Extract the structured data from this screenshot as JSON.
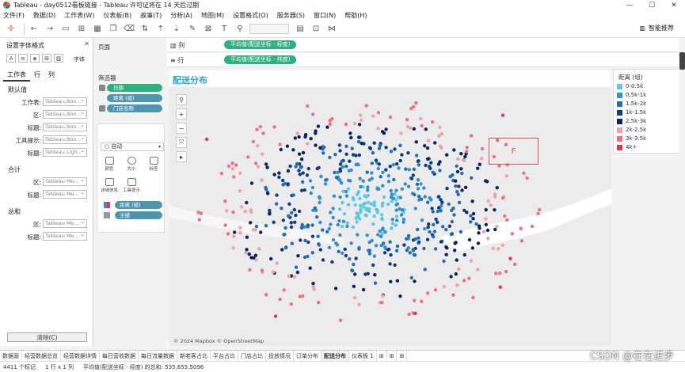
{
  "window": {
    "title": "Tableau - day0512看板链接 - Tableau 许可证将在 14 天后过期"
  },
  "menu": [
    "文件(F)",
    "数据(D)",
    "工作表(W)",
    "仪表板(B)",
    "故事(T)",
    "分析(A)",
    "地图(M)",
    "设置格式(O)",
    "服务器(S)",
    "窗口(N)",
    "帮助(H)"
  ],
  "toolbar": {
    "ai_label": "智能推荐"
  },
  "format_panel": {
    "title": "设置字体格式",
    "font_label": "字体",
    "tabs": [
      "工作表",
      "行",
      "列"
    ],
    "default_section": "默认值",
    "default_rows": [
      {
        "label": "工作表:",
        "value": "Tableau Boo..."
      },
      {
        "label": "区:",
        "value": "Tableau Boo..."
      },
      {
        "label": "标题:",
        "value": "Tableau Boo..."
      },
      {
        "label": "工具提示:",
        "value": "Tableau Boo..."
      },
      {
        "label": "标题:",
        "value": "Tableau Ligh..."
      }
    ],
    "total_section": "合计",
    "total_rows": [
      {
        "label": "区:",
        "value": "Tableau Me..."
      },
      {
        "label": "标题:",
        "value": "Tableau Me..."
      }
    ],
    "grand_section": "总和",
    "grand_rows": [
      {
        "label": "区:",
        "value": "Tableau Me..."
      },
      {
        "label": "标题:",
        "value": "Tableau Me..."
      }
    ],
    "clear_label": "清除(C)"
  },
  "cards": {
    "pages_label": "页面",
    "filters_label": "筛选器",
    "filters": [
      {
        "label": "日期",
        "color": "green"
      },
      {
        "label": "距离 (组)",
        "color": "blue"
      },
      {
        "label": "门店名称",
        "color": "blue"
      }
    ],
    "marks_label": "标记",
    "marks_type": "自动",
    "mark_buttons": [
      "颜色",
      "大小",
      "标签",
      "详细信息",
      "工具提示"
    ],
    "mark_pills": [
      "距离 (组)",
      "主键"
    ]
  },
  "shelves": {
    "columns_label": "列",
    "columns_pill": "平均值(配送坐标 - 经度)",
    "rows_label": "行",
    "rows_pill": "平均值(配送坐标 - 纬度)"
  },
  "viz": {
    "title": "配送分布",
    "attribution": "© 2024 Mapbox © OpenStreetMap",
    "annotation": "F"
  },
  "legend": {
    "title": "距离 (组)",
    "items": [
      {
        "label": "0-0.5k",
        "color": "#5bc8e8"
      },
      {
        "label": "0.5k-1k",
        "color": "#2f8fd6"
      },
      {
        "label": "1.5k-2k",
        "color": "#1f6dbb"
      },
      {
        "label": "1k-1.5k",
        "color": "#0d3f86"
      },
      {
        "label": "2.5k-3k",
        "color": "#0a2560"
      },
      {
        "label": "2k-2.5k",
        "color": "#f2a0ac"
      },
      {
        "label": "3k-3.5k",
        "color": "#ee6f86"
      },
      {
        "label": "4k+",
        "color": "#e5334d"
      }
    ]
  },
  "sheet_tabs": [
    "数据源",
    "经营数据总览",
    "经营数据详情",
    "每日营收数据",
    "每日流量数据",
    "新老客占比",
    "平台占比",
    "门店占比",
    "投放情况",
    "订单分布",
    "配送分布",
    "仪表板 1"
  ],
  "active_tab": "配送分布",
  "status": {
    "marks": "4411 个标记",
    "rows_cols": "1 行 x 1 列",
    "sum": "平均值(配送坐标 - 经度) 的总和: 535,655.5096"
  },
  "watermark": "CSDN @在在进步"
}
